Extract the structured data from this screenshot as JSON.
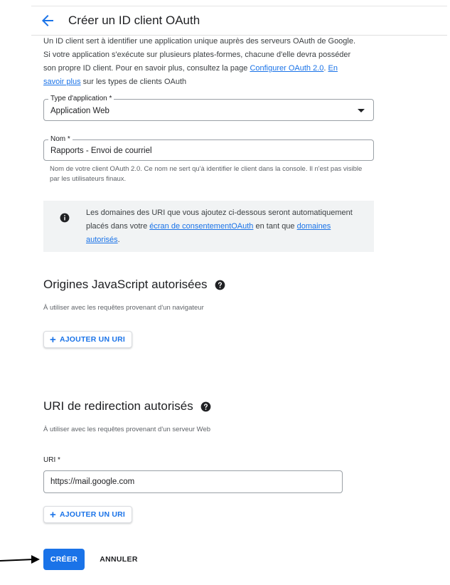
{
  "header": {
    "title": "Créer un ID client OAuth"
  },
  "intro": {
    "text_before": "Un ID client sert à identifier une application unique auprès des serveurs OAuth de Google. Si votre application s'exécute sur plusieurs plates-formes, chacune d'elle devra posséder son propre ID client. Pour en savoir plus, consultez la page ",
    "link1": "Configurer OAuth 2.0",
    "text_mid": ". ",
    "link2": "En savoir plus",
    "text_after": " sur les types de clients OAuth"
  },
  "app_type": {
    "label": "Type d'application *",
    "value": "Application Web"
  },
  "name_field": {
    "label": "Nom *",
    "value": "Rapports - Envoi de courriel",
    "hint": "Nom de votre client OAuth 2.0. Ce nom ne sert qu'à identifier le client dans la console. Il n'est pas visible par les utilisateurs finaux."
  },
  "info": {
    "text_before": "Les domaines des URI que vous ajoutez ci-dessous seront automatiquement placés dans votre ",
    "link1": "écran de consentementOAuth",
    "text_mid": " en tant que ",
    "link2": "domaines autorisés",
    "text_after": "."
  },
  "js_origins": {
    "title": "Origines JavaScript autorisées",
    "subtitle": "À utiliser avec les requêtes provenant d'un navigateur",
    "add_button": "AJOUTER UN URI"
  },
  "redirect_uris": {
    "title": "URI de redirection autorisés",
    "subtitle": "À utiliser avec les requêtes provenant d'un serveur Web",
    "uri_label": "URI *",
    "uri_value": "https://mail.google.com",
    "add_button": "AJOUTER UN URI"
  },
  "actions": {
    "create": "CRÉER",
    "cancel": "ANNULER"
  },
  "colors": {
    "accent": "#1a73e8",
    "info_bg": "#f1f3f4"
  }
}
